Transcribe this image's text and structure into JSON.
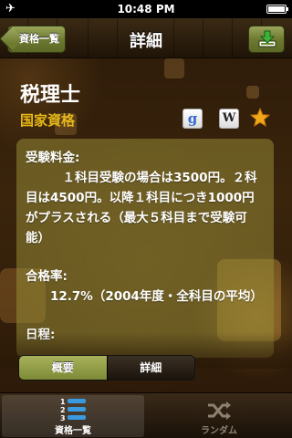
{
  "status_bar": {
    "time": "10:48 PM"
  },
  "nav": {
    "title": "詳細",
    "back_label": "資格一覧"
  },
  "detail": {
    "title": "税理士",
    "category": "国家資格",
    "google_icon_letter": "g",
    "wiki_icon_letter": "W",
    "fee_label": "受験料金:",
    "fee_text": "１科目受験の場合は3500円。２科目は4500円。以降１科目につき1000円がプラスされる（最大５科目まで受験可能）",
    "pass_rate_label": "合格率:",
    "pass_rate_text": "12.7%（2004年度・全科目の平均）",
    "schedule_label": "日程:"
  },
  "segment": {
    "summary": "概要",
    "detail": "詳細"
  },
  "tabbar": {
    "list_label": "資格一覧",
    "random_label": "ランダム",
    "list_icon_numbers": [
      "1",
      "2",
      "3"
    ]
  },
  "colors": {
    "accent_olive": "#7d8a36",
    "category_gold": "#e6b818",
    "star": "#f0a818"
  },
  "icons": [
    "airplane-icon",
    "battery-icon",
    "download-icon",
    "google-icon",
    "wikipedia-icon",
    "star-icon",
    "list-icon",
    "shuffle-icon"
  ]
}
